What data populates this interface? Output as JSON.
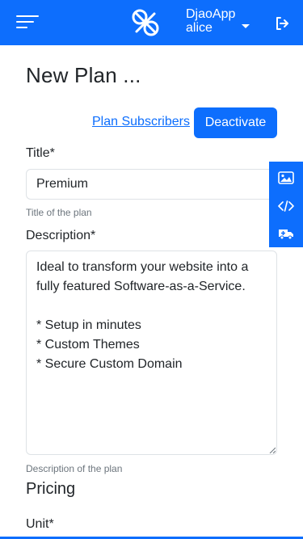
{
  "navbar": {
    "app_name": "DjaoApp",
    "user_name": "alice",
    "bg_color": "#0d6efd"
  },
  "page": {
    "title": "New Plan ...",
    "subscribers_link": "Plan Subscribers",
    "deactivate_button": "Deactivate"
  },
  "form": {
    "title_label": "Title*",
    "title_value": "Premium",
    "title_help": "Title of the plan",
    "description_label": "Description*",
    "description_value": "Ideal to transform your website into a fully featured Software-as-a-Service.\n\n* Setup in minutes\n* Custom Themes\n* Secure Custom Domain",
    "description_help": "Description of the plan",
    "pricing_heading": "Pricing",
    "unit_label": "Unit*"
  },
  "side_toolbar": {
    "items": [
      "image-icon",
      "code-icon",
      "ambulance-icon"
    ]
  }
}
